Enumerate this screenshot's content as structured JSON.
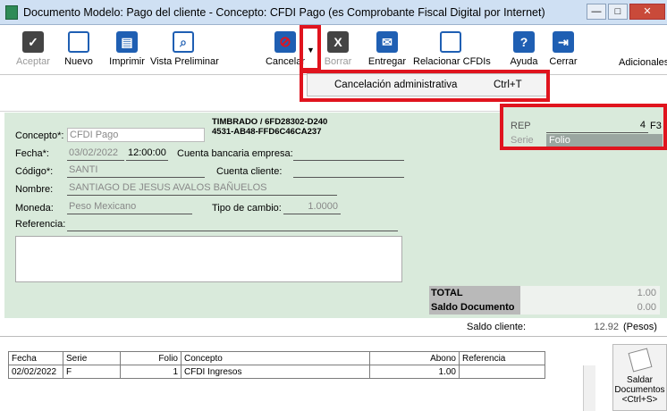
{
  "window": {
    "title": "Documento Modelo: Pago del cliente - Concepto: CFDI Pago (es Comprobante Fiscal Digital por Internet)",
    "minimize": "—",
    "maximize": "□",
    "close": "✕"
  },
  "toolbar": {
    "aceptar": "Aceptar",
    "nuevo": "Nuevo",
    "imprimir": "Imprimir",
    "vista_preliminar": "Vista Preliminar",
    "cancelar": "Cancelar",
    "borrar": "Borrar",
    "entregar": "Entregar",
    "relacionar": "Relacionar CFDIs",
    "ayuda": "Ayuda",
    "cerrar": "Cerrar",
    "adicionales": "Adicionales"
  },
  "dropdown": {
    "item": "Cancelación administrativa",
    "shortcut": "Ctrl+T"
  },
  "form": {
    "timbrado_line1": "TIMBRADO / 6FD28302-D240",
    "timbrado_line2": "4531-AB48-FFD6C46CA237",
    "concepto_label": "Concepto*:",
    "concepto_value": "CFDI Pago",
    "fecha_label": "Fecha*:",
    "fecha_value": "03/02/2022",
    "hora_value": "12:00:00",
    "cuenta_bancaria_label": "Cuenta bancaria empresa:",
    "codigo_label": "Código*:",
    "codigo_value": "SANTI",
    "cuenta_cliente_label": "Cuenta cliente:",
    "nombre_label": "Nombre:",
    "nombre_value": "SANTIAGO DE JESUS AVALOS BAÑUELOS",
    "moneda_label": "Moneda:",
    "moneda_value": "Peso Mexicano",
    "tipo_cambio_label": "Tipo de cambio:",
    "tipo_cambio_value": "1.0000",
    "referencia_label": "Referencia:"
  },
  "rep": {
    "rep_label": "REP",
    "rep_value": "4",
    "f3": "F3",
    "serie_label": "Serie",
    "folio_label": "Folio"
  },
  "totals": {
    "total_label": "TOTAL",
    "total_value": "1.00",
    "saldo_label": "Saldo Documento",
    "saldo_value": "0.00"
  },
  "saldo_cliente": {
    "label": "Saldo cliente:",
    "value": "12.92",
    "unit": "(Pesos)"
  },
  "grid": {
    "headers": [
      "Fecha",
      "Serie",
      "Folio",
      "Concepto",
      "Abono",
      "Referencia"
    ],
    "rows": [
      [
        "02/02/2022",
        "F",
        "1",
        "CFDI Ingresos",
        "1.00",
        ""
      ]
    ]
  },
  "saldar": {
    "line1": "Saldar",
    "line2": "Documentos",
    "line3": "<Ctrl+S>"
  },
  "colors": {
    "form_bg": "#d9eadb",
    "highlight": "#e0141e",
    "titlebar": "#cfe0f3"
  }
}
